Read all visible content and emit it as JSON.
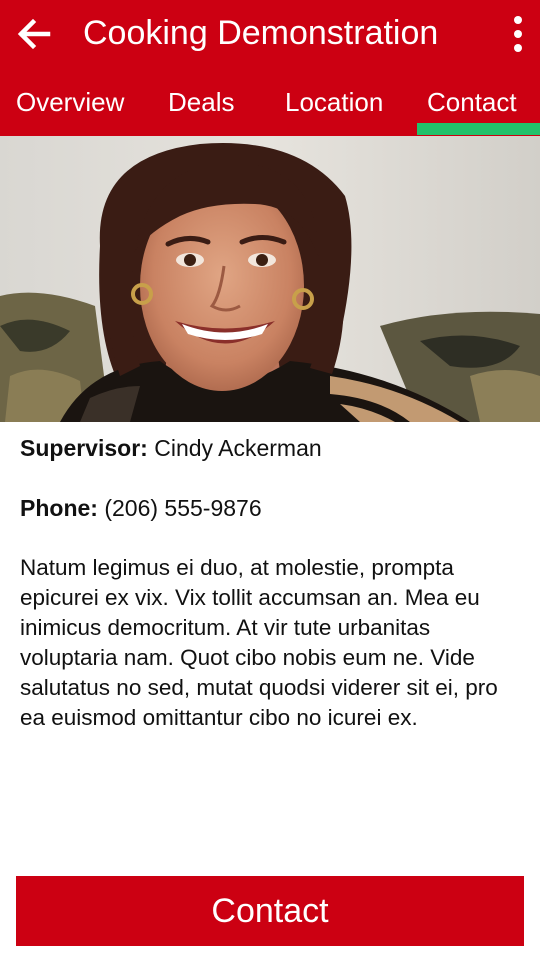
{
  "app": {
    "title": "Cooking Demonstration",
    "accent_color": "#cc0012",
    "tab_indicator_color": "#22c16b"
  },
  "toolbar": {
    "back_icon": "arrow-left-icon",
    "menu_icon": "more-vertical-icon"
  },
  "tabs": [
    {
      "label": "Overview",
      "selected": false
    },
    {
      "label": "Deals",
      "selected": false
    },
    {
      "label": "Location",
      "selected": false
    },
    {
      "label": "Contact",
      "selected": true
    }
  ],
  "contact": {
    "supervisor_label": "Supervisor:",
    "supervisor_name": "Cindy Ackerman",
    "phone_label": "Phone:",
    "phone_value": "(206) 555-9876",
    "description": "Natum legimus ei duo, at molestie, prompta epicurei ex vix. Vix tollit accumsan an. Mea eu inimicus democritum. At vir tute urbanitas voluptaria nam. Quot cibo nobis eum ne. Vide salutatus no sed, mutat quodsi viderer sit ei, pro ea euismod omittantur cibo no icurei ex."
  },
  "actions": {
    "contact_button": "Contact"
  }
}
